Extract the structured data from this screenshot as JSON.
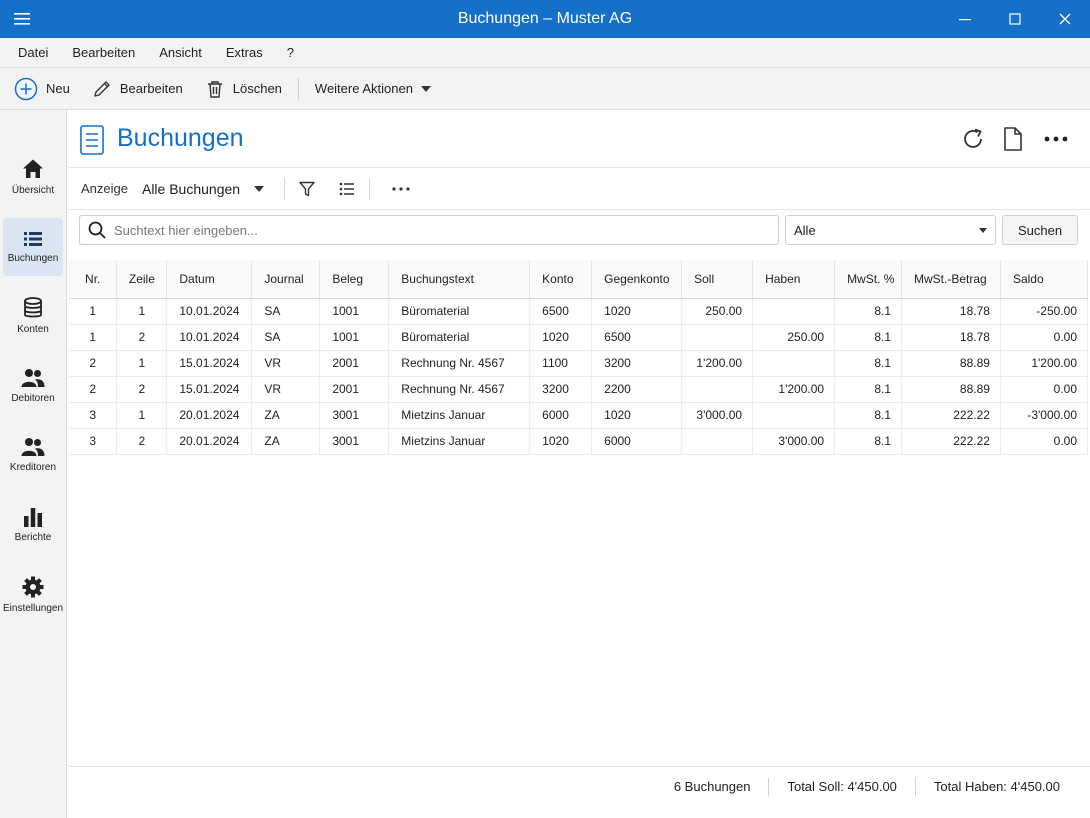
{
  "window": {
    "title": "Buchungen – Muster AG"
  },
  "menu": [
    "Datei",
    "Bearbeiten",
    "Ansicht",
    "Extras",
    "?"
  ],
  "toolbar": {
    "new": "Neu",
    "edit": "Bearbeiten",
    "delete": "Löschen",
    "more": "Weitere Aktionen"
  },
  "sidebar": {
    "items": [
      {
        "label": "Übersicht",
        "icon": "home-icon"
      },
      {
        "label": "Buchungen",
        "icon": "list-icon"
      },
      {
        "label": "Konten",
        "icon": "database-icon"
      },
      {
        "label": "Debitoren",
        "icon": "people-icon"
      },
      {
        "label": "Kreditoren",
        "icon": "people-icon"
      },
      {
        "label": "Berichte",
        "icon": "bar-chart-icon"
      },
      {
        "label": "Einstellungen",
        "icon": "gear-icon"
      }
    ]
  },
  "page": {
    "title": "Buchungen"
  },
  "filter": {
    "label": "Anzeige",
    "value": "Alle Buchungen"
  },
  "search": {
    "placeholder": "Suchtext hier eingeben...",
    "scope": "Alle",
    "button": "Suchen"
  },
  "table": {
    "columns": [
      "Nr.",
      "Zeile",
      "Datum",
      "Journal",
      "Beleg",
      "Buchungstext",
      "Konto",
      "Gegenkonto",
      "Soll",
      "Haben",
      "MwSt. %",
      "MwSt.-Betrag",
      "Saldo"
    ],
    "rows": [
      [
        "1",
        "1",
        "10.01.2024",
        "SA",
        "1001",
        "Büromaterial",
        "6500",
        "1020",
        "250.00",
        "",
        "8.1",
        "18.78",
        "-250.00"
      ],
      [
        "1",
        "2",
        "10.01.2024",
        "SA",
        "1001",
        "Büromaterial",
        "1020",
        "6500",
        "",
        "250.00",
        "8.1",
        "18.78",
        "0.00"
      ],
      [
        "2",
        "1",
        "15.01.2024",
        "VR",
        "2001",
        "Rechnung Nr. 4567",
        "1100",
        "3200",
        "1'200.00",
        "",
        "8.1",
        "88.89",
        "1'200.00"
      ],
      [
        "2",
        "2",
        "15.01.2024",
        "VR",
        "2001",
        "Rechnung Nr. 4567",
        "3200",
        "2200",
        "",
        "1'200.00",
        "8.1",
        "88.89",
        "0.00"
      ],
      [
        "3",
        "1",
        "20.01.2024",
        "ZA",
        "3001",
        "Mietzins Januar",
        "6000",
        "1020",
        "3'000.00",
        "",
        "8.1",
        "222.22",
        "-3'000.00"
      ],
      [
        "3",
        "2",
        "20.01.2024",
        "ZA",
        "3001",
        "Mietzins Januar",
        "1020",
        "6000",
        "",
        "3'000.00",
        "8.1",
        "222.22",
        "0.00"
      ]
    ]
  },
  "status": {
    "count": "6 Buchungen",
    "total_soll": "Total Soll: 4'450.00",
    "total_haben": "Total Haben: 4'450.00"
  },
  "colors": {
    "accent": "#1570c7",
    "sidebar_active": "#dbe5f1"
  }
}
